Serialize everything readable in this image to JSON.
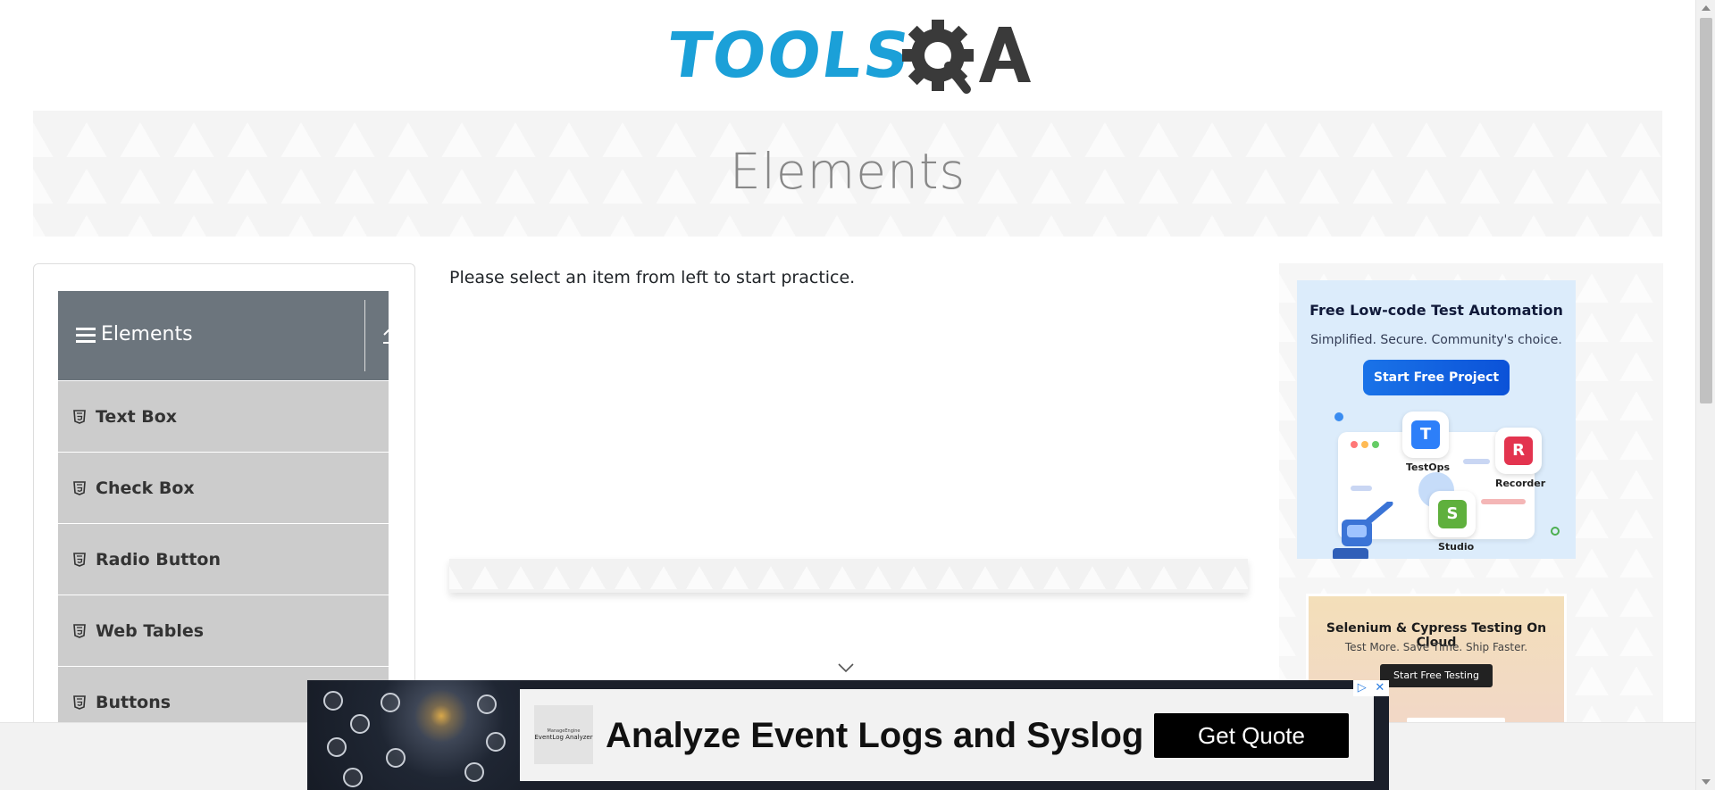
{
  "header": {
    "logo_tools": "TOOLS",
    "logo_qa": "QA"
  },
  "banner": {
    "title": "Elements"
  },
  "sidebar": {
    "group_title": "Elements",
    "items": [
      {
        "label": "Text Box"
      },
      {
        "label": "Check Box"
      },
      {
        "label": "Radio Button"
      },
      {
        "label": "Web Tables"
      },
      {
        "label": "Buttons"
      }
    ]
  },
  "main": {
    "instruction": "Please select an item from left to start practice."
  },
  "ads": {
    "ad1": {
      "title": "Free Low-code Test Automation",
      "subtitle": "Simplified. Secure. Community's choice.",
      "button": "Start Free Project",
      "products": [
        "TestOps",
        "Recorder",
        "Studio"
      ],
      "product_letters": [
        "T",
        "R",
        "S"
      ]
    },
    "ad2": {
      "title": "Selenium & Cypress Testing On Cloud",
      "subtitle": "Test More. Save Time. Ship Faster.",
      "button": "Start Free Testing"
    },
    "bottom": {
      "brand_line1": "ManageEngine",
      "brand_line2": "EventLog Analyzer",
      "headline": "Analyze Event Logs and Syslog",
      "button": "Get Quote",
      "choices_play": "▷",
      "choices_close": "✕"
    }
  },
  "colors": {
    "logo_blue": "#1ba0d8",
    "logo_dark": "#3a3a3a",
    "group_header": "#6c757d",
    "menu_item": "#cccccc",
    "ad_button_blue": "#1a73e8"
  },
  "icons": {
    "menu": "hamburger-icon",
    "collapse": "upload-arrow-icon",
    "item": "html5-shield-icon",
    "scroll_hint": "chevron-down-icon"
  }
}
